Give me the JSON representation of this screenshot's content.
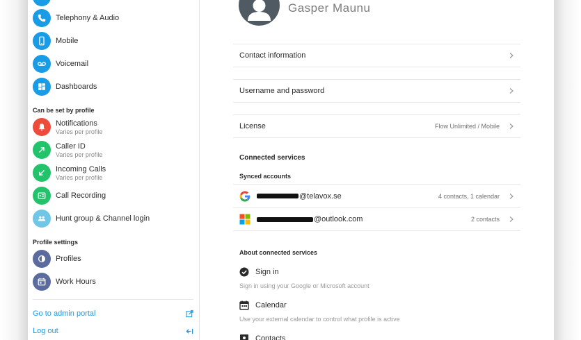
{
  "sidebar": {
    "personal_items": [
      {
        "label": "Telephony & Audio",
        "icon": "phone-icon",
        "color": "#1a9be6"
      },
      {
        "label": "Mobile",
        "icon": "mobile-icon",
        "color": "#1a9be6"
      },
      {
        "label": "Voicemail",
        "icon": "voicemail-icon",
        "color": "#1a9be6"
      },
      {
        "label": "Dashboards",
        "icon": "dashboard-icon",
        "color": "#1a9be6"
      }
    ],
    "profile_section_title": "Can be set by profile",
    "profile_items": [
      {
        "label": "Notifications",
        "sub": "Varies per profile",
        "icon": "bell-icon",
        "color": "#ee4b3a"
      },
      {
        "label": "Caller ID",
        "sub": "Varies per profile",
        "icon": "outgoing-arrow-icon",
        "color": "#22c36b"
      },
      {
        "label": "Incoming Calls",
        "sub": "Varies per profile",
        "icon": "incoming-arrow-icon",
        "color": "#22c36b"
      },
      {
        "label": "Call Recording",
        "icon": "recording-icon",
        "color": "#22c36b"
      },
      {
        "label": "Hunt group & Channel login",
        "icon": "group-icon",
        "color": "#6fc6e6"
      }
    ],
    "settings_section_title": "Profile settings",
    "settings_items": [
      {
        "label": "Profiles",
        "icon": "profiles-icon",
        "color": "#5b6b9e"
      },
      {
        "label": "Work Hours",
        "icon": "calendar-clock-icon",
        "color": "#5b6b9e"
      }
    ],
    "admin_link": "Go to admin portal",
    "logout_link": "Log out"
  },
  "profile": {
    "name": "Gasper Maunu"
  },
  "rows": {
    "contact": "Contact information",
    "username": "Username and password",
    "license": "License",
    "license_value": "Flow Unlimited / Mobile"
  },
  "connected": {
    "title": "Connected services",
    "synced_title": "Synced accounts",
    "accounts": [
      {
        "provider": "google-logo-icon",
        "email_suffix": "@telavox.se",
        "summary": "4 contacts, 1 calendar"
      },
      {
        "provider": "microsoft-logo-icon",
        "email_suffix": "@outlook.com",
        "summary": "2 contacts"
      }
    ]
  },
  "about": {
    "title": "About connected services",
    "items": [
      {
        "title": "Sign in",
        "desc": "Sign in using your Google or Microsoft account",
        "icon": "check-circle-icon"
      },
      {
        "title": "Calendar",
        "desc": "Use your external calendar to control what profile is active",
        "icon": "calendar-icon"
      },
      {
        "title": "Contacts",
        "icon": "contacts-icon"
      }
    ]
  },
  "colors": {
    "accent": "#1a9be6",
    "red": "#ee4b3a",
    "green": "#22c36b",
    "light_blue": "#6fc6e6",
    "indigo": "#5b6b9e"
  }
}
